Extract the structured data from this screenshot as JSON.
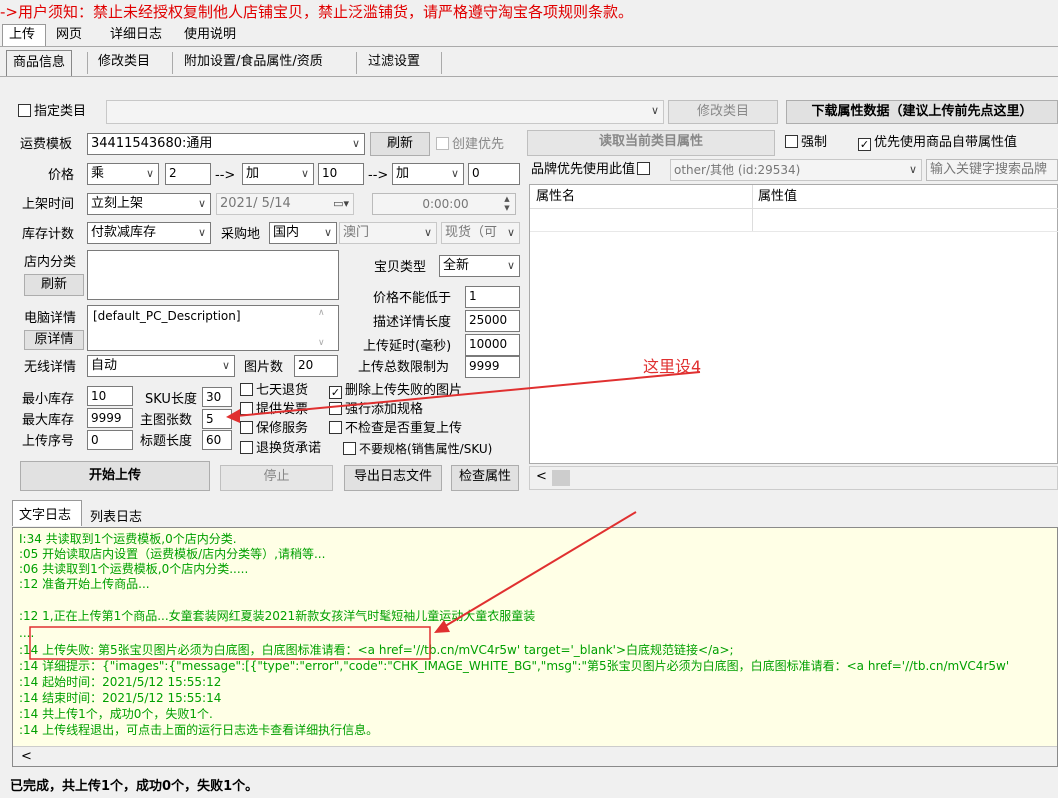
{
  "notice": "->用户须知：禁止未经授权复制他人店铺宝贝，禁止泛滥铺货，请严格遵守淘宝各项规则条款。",
  "top_tabs": [
    "上传",
    "网页",
    "详细日志",
    "使用说明"
  ],
  "sub_tabs": [
    "商品信息",
    "修改类目",
    "附加设置/食品属性/资质",
    "过滤设置"
  ],
  "category": {
    "checkbox_label": "指定类目",
    "modify_button": "修改类目",
    "download_button": "下载属性数据（建议上传前先点这里）"
  },
  "shipping": {
    "label": "运费模板",
    "value": "34411543680:通用",
    "refresh_button": "刷新",
    "create_first_label": "创建优先"
  },
  "attr_panel": {
    "read_button": "读取当前类目属性",
    "force_label": "强制",
    "prefer_label": "优先使用商品自带属性值",
    "prefer_checked": "✓",
    "brand_label": "品牌优先使用此值",
    "brand_value": "other/其他 (id:29534)",
    "keyword_placeholder": "输入关键字搜索品牌",
    "col_name": "属性名",
    "col_value": "属性值"
  },
  "price": {
    "label": "价格",
    "op1": "乘",
    "val1": "2",
    "arrow1": "-->",
    "op2": "加",
    "val2": "10",
    "arrow2": "-->",
    "op3": "加",
    "val3": "0"
  },
  "listing": {
    "label": "上架时间",
    "mode": "立刻上架",
    "date": "2021/ 5/14",
    "time": "0:00:00"
  },
  "stock": {
    "label": "库存计数",
    "mode": "付款减库存",
    "origin_label": "采购地",
    "origin": "国内",
    "region": "澳门",
    "goods": "现货（可"
  },
  "shop_category": {
    "label": "店内分类",
    "refresh_button": "刷新"
  },
  "item_type": {
    "label": "宝贝类型",
    "value": "全新"
  },
  "pc_detail": {
    "label": "电脑详情",
    "value": "[default_PC_Description]",
    "orig_button": "原详情"
  },
  "limits": {
    "min_price_label": "价格不能低于",
    "min_price": "1",
    "desc_len_label": "描述详情长度",
    "desc_len": "25000",
    "delay_label": "上传延时(毫秒)",
    "delay": "10000",
    "total_label": "上传总数限制为",
    "total": "9999"
  },
  "wireless": {
    "label": "无线详情",
    "value": "自动",
    "img_label": "图片数",
    "img_value": "20"
  },
  "fields": {
    "min_stock_label": "最小库存",
    "min_stock": "10",
    "max_stock_label": "最大库存",
    "max_stock": "9999",
    "seq_label": "上传序号",
    "seq": "0",
    "sku_len_label": "SKU长度",
    "sku_len": "30",
    "main_img_label": "主图张数",
    "main_img": "5",
    "title_len_label": "标题长度",
    "title_len": "60"
  },
  "options": [
    {
      "label": "七天退货",
      "checked": ""
    },
    {
      "label": "删除上传失败的图片",
      "checked": "✓"
    },
    {
      "label": "提供发票",
      "checked": ""
    },
    {
      "label": "强行添加规格",
      "checked": ""
    },
    {
      "label": "保修服务",
      "checked": ""
    },
    {
      "label": "不检查是否重复上传",
      "checked": ""
    },
    {
      "label": "退换货承诺",
      "checked": ""
    },
    {
      "label": "不要规格(销售属性/SKU)",
      "checked": ""
    }
  ],
  "actions": {
    "start": "开始上传",
    "stop": "停止",
    "export": "导出日志文件",
    "check": "检查属性"
  },
  "log_tabs": [
    "文字日志",
    "列表日志"
  ],
  "log_lines": [
    "I:34  共读取到1个运费模板,0个店内分类.",
    ":05  开始读取店内设置（运费模板/店内分类等）,请稍等...",
    ":06  共读取到1个运费模板,0个店内分类.....",
    ":12  准备开始上传商品...",
    ":12  1,正在上传第1个商品...女童套装网红夏装2021新款女孩洋气时髦短袖儿童运动大童衣服童装",
    "....",
    ":14  上传失败: 第5张宝贝图片必须为白底图，白底图标准请看：<a href='//tb.cn/mVC4r5w' target='_blank'>白底规范链接</a>;",
    ":14  详细提示：{\"images\":{\"message\":[{\"type\":\"error\",\"code\":\"CHK_IMAGE_WHITE_BG\",\"msg\":\"第5张宝贝图片必须为白底图，白底图标准请看：<a href='//tb.cn/mVC4r5w'",
    ":14  起始时间：2021/5/12 15:55:12",
    ":14  结束时间：2021/5/12 15:55:14",
    ":14  共上传1个，成功0个，失败1个.",
    ":14  上传线程退出，可点击上面的运行日志选卡查看详细执行信息。"
  ],
  "status": "已完成，共上传1个，成功0个，失败1个。",
  "annotation": "这里设4",
  "colors": {
    "notice": "#e00000",
    "log_text": "#00a000",
    "annotation": "#e03030",
    "log_bg": "#ffffe6"
  }
}
